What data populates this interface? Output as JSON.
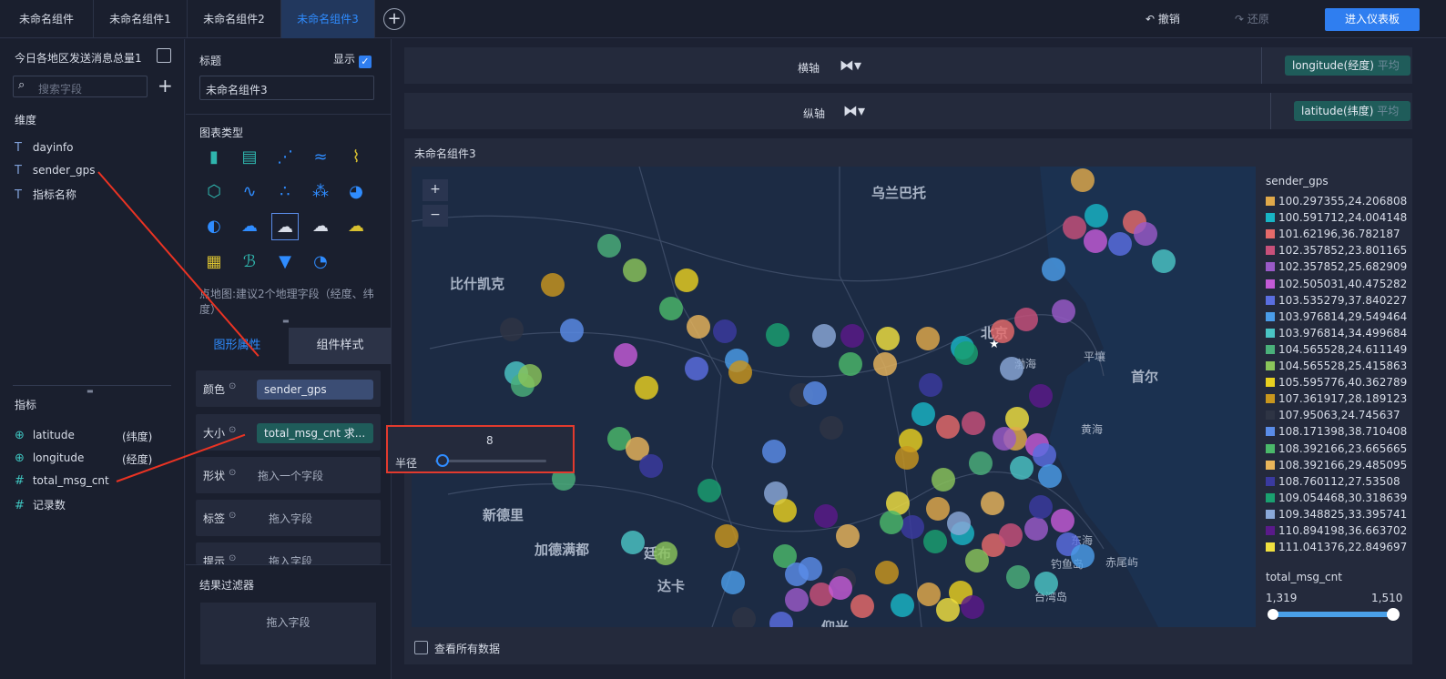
{
  "tabs": [
    "未命名组件",
    "未命名组件1",
    "未命名组件2",
    "未命名组件3"
  ],
  "toolbar": {
    "undo": "撤销",
    "redo": "还原",
    "enter": "进入仪表板"
  },
  "dataset": {
    "name": "今日各地区发送消息总量1",
    "search_placeholder": "搜索字段"
  },
  "dimensions": {
    "title": "维度",
    "items": [
      "dayinfo",
      "sender_gps",
      "指标名称"
    ]
  },
  "measures": {
    "title": "指标",
    "items": [
      {
        "name": "latitude",
        "alias": "(纬度)"
      },
      {
        "name": "longitude",
        "alias": "(经度)"
      },
      {
        "name": "total_msg_cnt",
        "alias": ""
      },
      {
        "name": "记录数",
        "alias": ""
      }
    ]
  },
  "config": {
    "title_label": "标题",
    "show_label": "显示",
    "title_value": "未命名组件3",
    "chart_type_label": "图表类型",
    "hint": "点地图:建议2个地理字段（经度、纬度）",
    "tab_graphic": "图形属性",
    "tab_style": "组件样式",
    "color_label": "颜色",
    "color_field": "sender_gps",
    "size_label": "大小",
    "size_field": "total_msg_cnt 求...",
    "shape_label": "形状",
    "shape_drop": "拖入一个字段",
    "label_label": "标签",
    "label_drop": "拖入字段",
    "tooltip_label": "提示",
    "tooltip_drop": "拖入字段",
    "filter_label": "结果过滤器",
    "filter_drop": "拖入字段"
  },
  "axes": {
    "x_label": "横轴",
    "x_field": "longitude(经度)",
    "x_agg": "平均",
    "y_label": "纵轴",
    "y_field": "latitude(纬度)",
    "y_agg": "平均"
  },
  "chart": {
    "title": "未命名组件3",
    "view_all": "查看所有数据",
    "zoom_in": "+",
    "zoom_out": "−"
  },
  "map_places": [
    "乌兰巴托",
    "比什凯克",
    "新德里",
    "加德满都",
    "廷布",
    "达卡",
    "北京",
    "平壤",
    "首尔",
    "渤海",
    "黄海",
    "东海",
    "台湾岛",
    "钓鱼岛",
    "赤尾屿",
    "仰光"
  ],
  "popup": {
    "value": "8",
    "radius_label": "半径"
  },
  "legend": {
    "title": "sender_gps",
    "items": [
      {
        "label": "100.297355,24.206808",
        "color": "#e0a94a"
      },
      {
        "label": "100.591712,24.004148",
        "color": "#18b4c4"
      },
      {
        "label": "101.62196,36.782187",
        "color": "#e56a6a"
      },
      {
        "label": "102.357852,23.801165",
        "color": "#c8507a"
      },
      {
        "label": "102.357852,25.682909",
        "color": "#9a5ac8"
      },
      {
        "label": "102.505031,40.475282",
        "color": "#c35ad6"
      },
      {
        "label": "103.535279,37.840227",
        "color": "#5a6ee0"
      },
      {
        "label": "103.976814,29.549464",
        "color": "#4a9ce8"
      },
      {
        "label": "103.976814,34.499684",
        "color": "#4ac4c4"
      },
      {
        "label": "104.565528,24.611149",
        "color": "#4ab07a"
      },
      {
        "label": "104.565528,25.415863",
        "color": "#8ac45a"
      },
      {
        "label": "105.595776,40.362789",
        "color": "#e8d020"
      },
      {
        "label": "107.361917,28.189123",
        "color": "#c8961e"
      },
      {
        "label": "107.95063,24.745637",
        "color": "#2e3444"
      },
      {
        "label": "108.171398,38.710408",
        "color": "#5a8ce8"
      },
      {
        "label": "108.392166,23.665665",
        "color": "#4ab86a"
      },
      {
        "label": "108.392166,29.485095",
        "color": "#e8b45a"
      },
      {
        "label": "108.760112,27.53508",
        "color": "#3a3aa0"
      },
      {
        "label": "109.054468,30.318639",
        "color": "#1aa070"
      },
      {
        "label": "109.348825,33.395741",
        "color": "#8aa8d8"
      },
      {
        "label": "110.894198,36.663702",
        "color": "#5a1a8a"
      },
      {
        "label": "111.041376,22.849697",
        "color": "#f0e040"
      }
    ],
    "size_title": "total_msg_cnt",
    "size_min": "1,319",
    "size_max": "1,510"
  }
}
